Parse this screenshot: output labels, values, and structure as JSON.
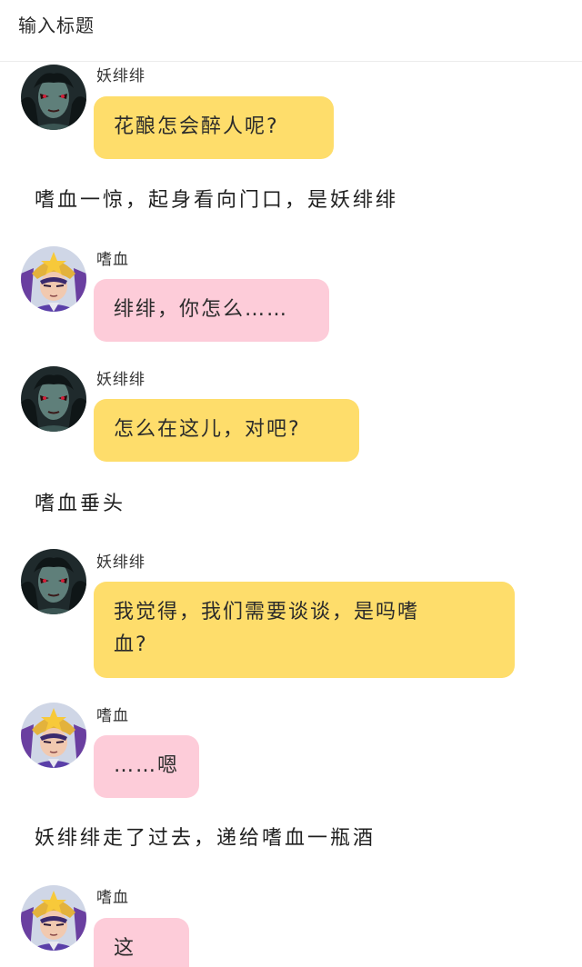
{
  "title_placeholder": "输入标题",
  "colors": {
    "yao_bubble": "#fedd6b",
    "shixue_bubble": "#fdccd9"
  },
  "messages": [
    {
      "type": "chat",
      "speaker": "妖绯绯",
      "avatar": "yaofeifei-avatar",
      "text": "花酿怎会醉人呢?"
    },
    {
      "type": "narration",
      "text": "嗜血一惊，起身看向门口，是妖绯绯"
    },
    {
      "type": "chat",
      "speaker": "嗜血",
      "avatar": "shixue-avatar",
      "text": "绯绯，你怎么……"
    },
    {
      "type": "chat",
      "speaker": "妖绯绯",
      "avatar": "yaofeifei-avatar",
      "text": "怎么在这儿，对吧?"
    },
    {
      "type": "narration",
      "text": "嗜血垂头"
    },
    {
      "type": "chat",
      "speaker": "妖绯绯",
      "avatar": "yaofeifei-avatar",
      "text_line1": "我觉得，我们需要谈谈，是吗嗜",
      "text_line2": "血?"
    },
    {
      "type": "chat",
      "speaker": "嗜血",
      "avatar": "shixue-avatar",
      "text": "……嗯"
    },
    {
      "type": "narration",
      "text": "妖绯绯走了过去，递给嗜血一瓶酒"
    },
    {
      "type": "chat",
      "speaker": "嗜血",
      "avatar": "shixue-avatar",
      "text": "这是?"
    }
  ]
}
